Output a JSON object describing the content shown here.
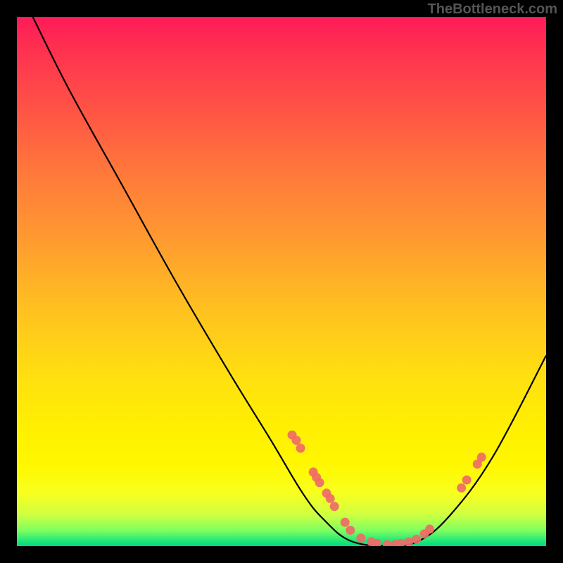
{
  "watermark": "TheBottleneck.com",
  "chart_data": {
    "type": "line",
    "title": "",
    "xlabel": "",
    "ylabel": "",
    "xlim": [
      0,
      100
    ],
    "ylim": [
      0,
      100
    ],
    "curve": [
      {
        "x": 3,
        "y": 100
      },
      {
        "x": 10,
        "y": 86
      },
      {
        "x": 20,
        "y": 68
      },
      {
        "x": 30,
        "y": 50
      },
      {
        "x": 40,
        "y": 33
      },
      {
        "x": 48,
        "y": 20
      },
      {
        "x": 54,
        "y": 10
      },
      {
        "x": 58,
        "y": 5
      },
      {
        "x": 63,
        "y": 1
      },
      {
        "x": 70,
        "y": 0
      },
      {
        "x": 76,
        "y": 1
      },
      {
        "x": 82,
        "y": 6
      },
      {
        "x": 90,
        "y": 17
      },
      {
        "x": 100,
        "y": 36
      }
    ],
    "markers": [
      {
        "x": 52,
        "y": 21
      },
      {
        "x": 52.8,
        "y": 20
      },
      {
        "x": 53.6,
        "y": 18.5
      },
      {
        "x": 56,
        "y": 14
      },
      {
        "x": 56.6,
        "y": 13
      },
      {
        "x": 57.2,
        "y": 12
      },
      {
        "x": 58.5,
        "y": 10
      },
      {
        "x": 59.2,
        "y": 9
      },
      {
        "x": 60,
        "y": 7.5
      },
      {
        "x": 62,
        "y": 4.5
      },
      {
        "x": 63,
        "y": 3
      },
      {
        "x": 65,
        "y": 1.5
      },
      {
        "x": 67,
        "y": 0.8
      },
      {
        "x": 68,
        "y": 0.5
      },
      {
        "x": 70,
        "y": 0.3
      },
      {
        "x": 71.5,
        "y": 0.3
      },
      {
        "x": 72.5,
        "y": 0.5
      },
      {
        "x": 74,
        "y": 0.8
      },
      {
        "x": 75.5,
        "y": 1.3
      },
      {
        "x": 77,
        "y": 2.3
      },
      {
        "x": 78,
        "y": 3.2
      },
      {
        "x": 84,
        "y": 11
      },
      {
        "x": 85,
        "y": 12.5
      },
      {
        "x": 87,
        "y": 15.5
      },
      {
        "x": 87.8,
        "y": 16.8
      }
    ],
    "gradient_stops": [
      {
        "pos": 0,
        "color": "#ff1a58"
      },
      {
        "pos": 50,
        "color": "#ffc020"
      },
      {
        "pos": 100,
        "color": "#00d880"
      }
    ]
  }
}
